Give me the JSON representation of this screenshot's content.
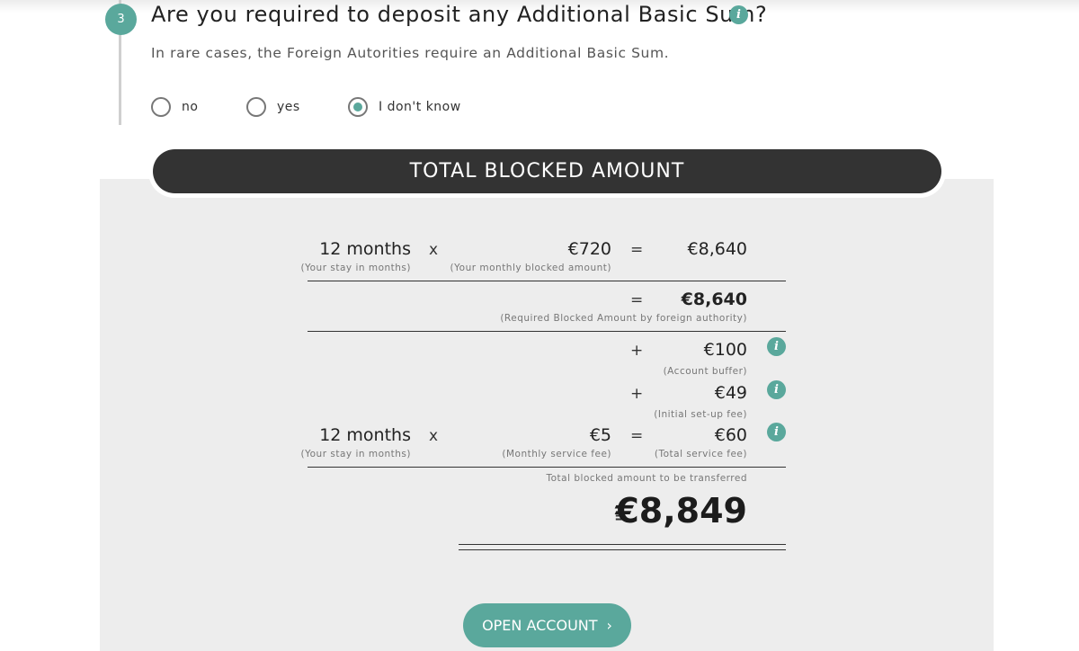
{
  "step": {
    "number": "3",
    "question": "Are you required to deposit any Additional Basic Sum?",
    "subtext": "In rare cases, the Foreign Autorities require an Additional Basic Sum.",
    "options": [
      {
        "label": "no",
        "selected": false
      },
      {
        "label": "yes",
        "selected": false
      },
      {
        "label": "I don't know",
        "selected": true
      }
    ]
  },
  "summary": {
    "title": "TOTAL BLOCKED AMOUNT",
    "row1": {
      "months": "12 months",
      "months_caption": "(Your stay in months)",
      "times": "x",
      "monthly_amount": "€720",
      "monthly_caption": "(Your monthly blocked amount)",
      "equals": "=",
      "result": "€8,640"
    },
    "required": {
      "equals": "=",
      "amount": "€8,640",
      "caption": "(Required Blocked Amount by foreign authority)"
    },
    "buffer": {
      "plus": "+",
      "amount": "€100",
      "caption": "(Account buffer)"
    },
    "setup": {
      "plus": "+",
      "amount": "€49",
      "caption": "(Initial set-up fee)"
    },
    "service": {
      "months": "12 months",
      "months_caption": "(Your stay in months)",
      "times": "x",
      "monthly_fee": "€5",
      "monthly_caption": "(Monthly service fee)",
      "equals": "=",
      "total": "€60",
      "total_caption": "(Total service fee)"
    },
    "total_caption": "Total blocked amount to be transferred",
    "total_equals": "=",
    "total_amount": "€8,849"
  },
  "cta": {
    "label": "OPEN ACCOUNT",
    "chevron": "›"
  },
  "colors": {
    "accent": "#5aa89c",
    "header_bg": "#333333",
    "panel_bg": "#ededed"
  },
  "icons": {
    "info": "info-icon",
    "chevron": "chevron-right-icon"
  }
}
